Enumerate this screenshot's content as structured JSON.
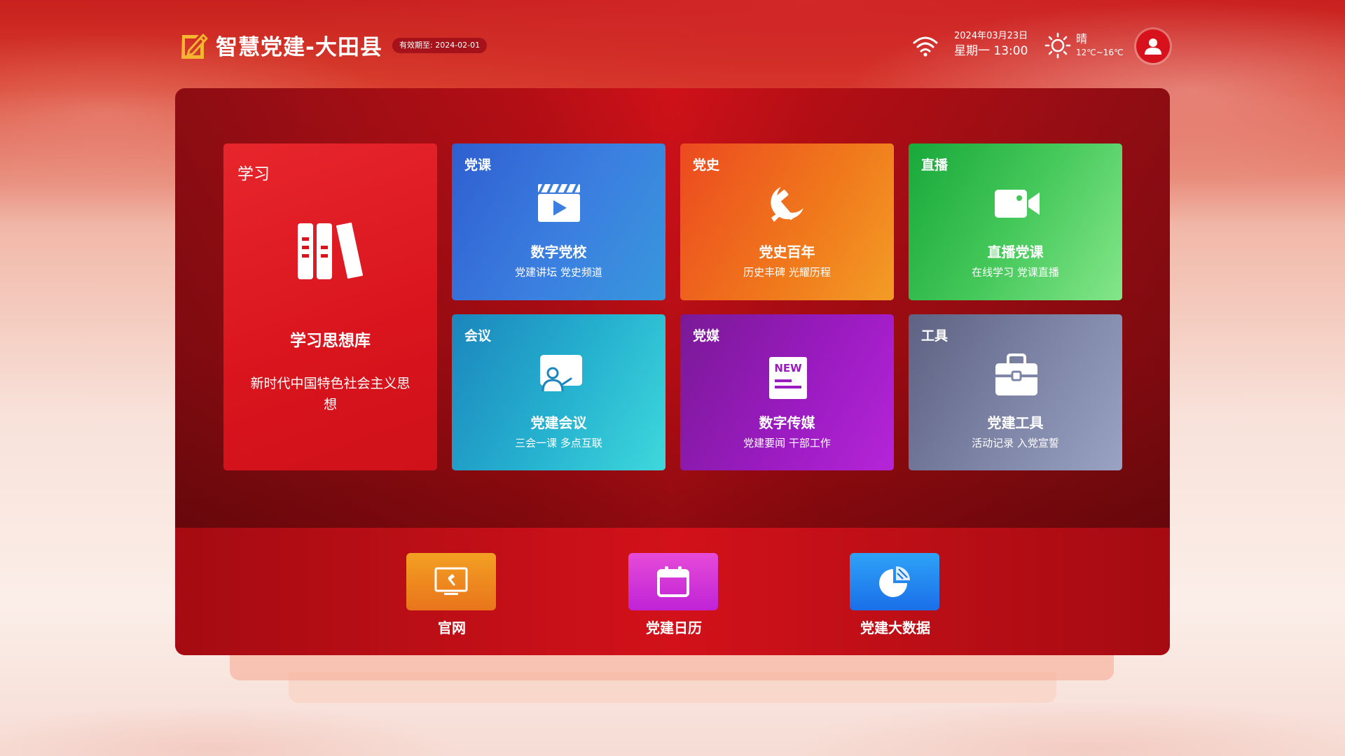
{
  "header": {
    "app_title": "智慧党建-大田县",
    "validity": "有效期至: 2024-02-01",
    "date": "2024年03月23日",
    "weekday_time": "星期一  13:00",
    "weather_condition": "晴",
    "temperature": "12℃~16℃"
  },
  "tiles": {
    "study": {
      "category": "学习",
      "name": "学习思想库",
      "subtitle": "新时代中国特色社会主义思想",
      "icon": "books-icon"
    },
    "course": {
      "category": "党课",
      "name": "数字党校",
      "subtitle": "党建讲坛 党史频道",
      "icon": "video-clapper-icon"
    },
    "history": {
      "category": "党史",
      "name": "党史百年",
      "subtitle": "历史丰碑 光耀历程",
      "icon": "hammer-sickle-icon"
    },
    "live": {
      "category": "直播",
      "name": "直播党课",
      "subtitle": "在线学习 党课直播",
      "icon": "video-camera-icon"
    },
    "meeting": {
      "category": "会议",
      "name": "党建会议",
      "subtitle": "三会一课 多点互联",
      "icon": "presentation-icon"
    },
    "media": {
      "category": "党媒",
      "name": "数字传媒",
      "subtitle": "党建要闻 干部工作",
      "icon": "news-icon",
      "badge": "NEW"
    },
    "tools": {
      "category": "工具",
      "name": "党建工具",
      "subtitle": "活动记录 入党宣誓",
      "icon": "toolbox-icon"
    }
  },
  "shortcuts": [
    {
      "label": "官网",
      "icon": "website-icon"
    },
    {
      "label": "党建日历",
      "icon": "calendar-icon"
    },
    {
      "label": "党建大数据",
      "icon": "pie-chart-icon"
    }
  ],
  "colors": {
    "primary_red": "#cf1119",
    "course_blue": "#3b7fe0",
    "history_orange": "#f07a1c",
    "live_green": "#45c85a",
    "meeting_cyan": "#26b3d0",
    "media_purple": "#9a1bc0",
    "tools_gray": "#7f86a8"
  }
}
